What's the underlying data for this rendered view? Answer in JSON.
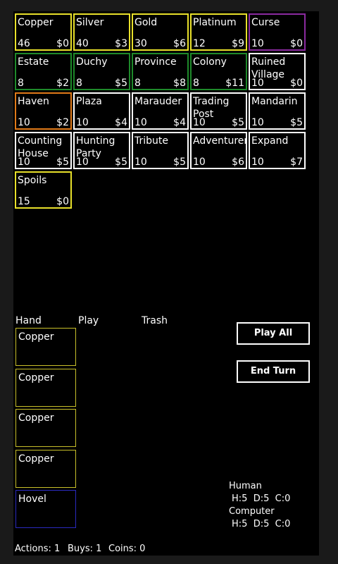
{
  "supply": [
    {
      "name": "Copper",
      "count": "46",
      "cost": "$0",
      "color": "#e8e02a"
    },
    {
      "name": "Silver",
      "count": "40",
      "cost": "$3",
      "color": "#e8e02a"
    },
    {
      "name": "Gold",
      "count": "30",
      "cost": "$6",
      "color": "#e8e02a"
    },
    {
      "name": "Platinum",
      "count": "12",
      "cost": "$9",
      "color": "#e8e02a"
    },
    {
      "name": "Curse",
      "count": "10",
      "cost": "$0",
      "color": "#8b2aa0"
    },
    {
      "name": "Estate",
      "count": "8",
      "cost": "$2",
      "color": "#1e8a2a"
    },
    {
      "name": "Duchy",
      "count": "8",
      "cost": "$5",
      "color": "#1e8a2a"
    },
    {
      "name": "Province",
      "count": "8",
      "cost": "$8",
      "color": "#1e8a2a"
    },
    {
      "name": "Colony",
      "count": "8",
      "cost": "$11",
      "color": "#1e8a2a"
    },
    {
      "name": "Ruined Village",
      "count": "10",
      "cost": "$0",
      "color": "#ffffff"
    },
    {
      "name": "Haven",
      "count": "10",
      "cost": "$2",
      "color": "#e07a18"
    },
    {
      "name": "Plaza",
      "count": "10",
      "cost": "$4",
      "color": "#ffffff"
    },
    {
      "name": "Marauder",
      "count": "10",
      "cost": "$4",
      "color": "#ffffff"
    },
    {
      "name": "Trading Post",
      "count": "10",
      "cost": "$5",
      "color": "#ffffff"
    },
    {
      "name": "Mandarin",
      "count": "10",
      "cost": "$5",
      "color": "#ffffff"
    },
    {
      "name": "Counting House",
      "count": "10",
      "cost": "$5",
      "color": "#ffffff"
    },
    {
      "name": "Hunting Party",
      "count": "10",
      "cost": "$5",
      "color": "#ffffff"
    },
    {
      "name": "Tribute",
      "count": "10",
      "cost": "$5",
      "color": "#ffffff"
    },
    {
      "name": "Adventurer",
      "count": "10",
      "cost": "$6",
      "color": "#ffffff"
    },
    {
      "name": "Expand",
      "count": "10",
      "cost": "$7",
      "color": "#ffffff"
    },
    {
      "name": "Spoils",
      "count": "15",
      "cost": "$0",
      "color": "#e8e02a"
    }
  ],
  "areas": {
    "hand": "Hand",
    "play": "Play",
    "trash": "Trash"
  },
  "hand": [
    {
      "name": "Copper",
      "color": "#c9c02a"
    },
    {
      "name": "Copper",
      "color": "#c9c02a"
    },
    {
      "name": "Copper",
      "color": "#c9c02a"
    },
    {
      "name": "Copper",
      "color": "#c9c02a"
    },
    {
      "name": "Hovel",
      "color": "#2a2ac0"
    }
  ],
  "buttons": {
    "play_all": "Play All",
    "end_turn": "End Turn"
  },
  "players": {
    "human_label": "Human",
    "human_stats": "H:5  D:5  C:0",
    "computer_label": "Computer",
    "computer_stats": "H:5  D:5  C:0"
  },
  "status": {
    "actions": "Actions: 1",
    "buys": "Buys: 1",
    "coins": "Coins: 0"
  }
}
